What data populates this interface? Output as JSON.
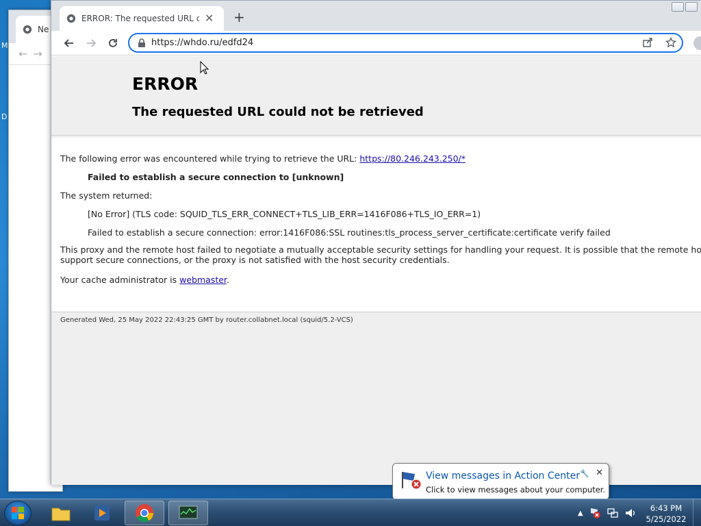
{
  "desktop": {
    "left_fragments": [
      "M",
      "D"
    ]
  },
  "background_window": {
    "tab_title_fragment": "Ne"
  },
  "browser": {
    "tab": {
      "title": "ERROR: The requested URL could not be retrieved"
    },
    "address": {
      "url": "https://whdo.ru/edfd24"
    }
  },
  "page": {
    "title": "ERROR",
    "subtitle": "The requested URL could not be retrieved",
    "intro": "The following error was encountered while trying to retrieve the URL: ",
    "intro_link": "https://80.246.243.250/*",
    "failed": "Failed to establish a secure connection to [unknown]",
    "system_returned": "The system returned:",
    "tls_error": "[No Error] (TLS code: SQUID_TLS_ERR_CONNECT+TLS_LIB_ERR=1416F086+TLS_IO_ERR=1)",
    "ssl_error": "Failed to establish a secure connection: error:1416F086:SSL routines:tls_process_server_certificate:certificate verify failed",
    "explanation_line1": "This proxy and the remote host failed to negotiate a mutually acceptable security settings for handling your request. It is possible that the remote host do",
    "explanation_line2": "support secure connections, or the proxy is not satisfied with the host security credentials.",
    "admin_prefix": "Your cache administrator is ",
    "admin_link": "webmaster",
    "admin_suffix": ".",
    "generated": "Generated Wed, 25 May 2022 22:43:25 GMT by router.collabnet.local (squid/5.2-VCS)"
  },
  "notification": {
    "title": "View messages in Action Center",
    "text": "Click to view messages about your computer."
  },
  "taskbar": {
    "time": "6:43 PM",
    "date": "5/25/2022",
    "items": [
      "explorer-icon",
      "media-player-icon",
      "chrome-icon",
      "task-manager-icon"
    ]
  },
  "colors": {
    "accent": "#1a73e8",
    "link": "#1a0dab",
    "taskbar": "#2c4f73"
  }
}
